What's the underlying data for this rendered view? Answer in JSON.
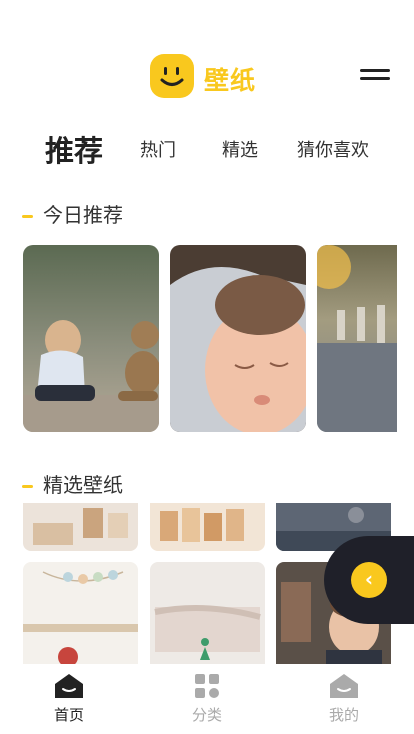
{
  "app": {
    "title": "壁纸",
    "accent": "#f9c81e"
  },
  "tabs": [
    {
      "label": "推荐",
      "active": true
    },
    {
      "label": "热门"
    },
    {
      "label": "精选"
    },
    {
      "label": "猜你喜欢"
    }
  ],
  "sections": {
    "today": "今日推荐",
    "featured": "精选壁纸"
  },
  "nav": [
    {
      "label": "首页",
      "icon": "home-icon",
      "active": true
    },
    {
      "label": "分类",
      "icon": "category-icon"
    },
    {
      "label": "我的",
      "icon": "profile-icon"
    }
  ],
  "floating_button": {
    "icon": "chevron-left-icon",
    "symbol": "‹"
  }
}
